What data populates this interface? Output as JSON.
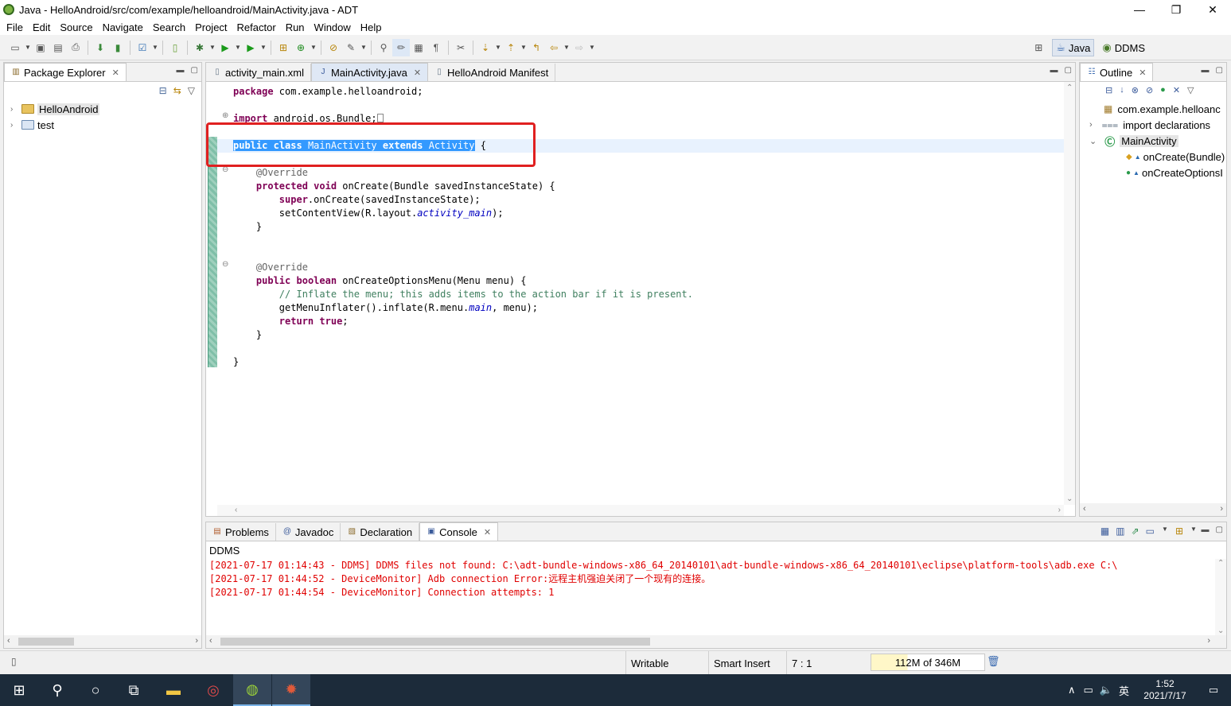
{
  "window": {
    "title": "Java - HelloAndroid/src/com/example/helloandroid/MainActivity.java - ADT",
    "minimize": "—",
    "restore": "❐",
    "close": "✕"
  },
  "menu": [
    "File",
    "Edit",
    "Source",
    "Navigate",
    "Search",
    "Project",
    "Refactor",
    "Run",
    "Window",
    "Help"
  ],
  "perspectives": {
    "java": "Java",
    "ddms": "DDMS"
  },
  "package_explorer": {
    "tab": "Package Explorer",
    "items": [
      {
        "label": "HelloAndroid"
      },
      {
        "label": "test"
      }
    ]
  },
  "editor": {
    "tabs": [
      "activity_main.xml",
      "MainActivity.java",
      "HelloAndroid Manifest"
    ],
    "active_tab": "MainActivity.java",
    "code": {
      "l1_kw": "package",
      "l1_rest": " com.example.helloandroid;",
      "l3_kw": "import",
      "l3_rest": " android.os.Bundle;",
      "l5_kw1": "public",
      "l5_kw2": "class",
      "l5_name": "MainActivity",
      "l5_kw3": "extends",
      "l5_super": "Activity",
      "l5_brace": " {",
      "l7": "@Override",
      "l8_kw1": "protected",
      "l8_kw2": "void",
      "l8_rest": " onCreate(Bundle savedInstanceState) {",
      "l9_kw": "super",
      "l9_rest": ".onCreate(savedInstanceState);",
      "l10_a": "setContentView(R.layout.",
      "l10_field": "activity_main",
      "l10_b": ");",
      "l11": "}",
      "l14": "@Override",
      "l15_kw1": "public",
      "l15_kw2": "boolean",
      "l15_rest": " onCreateOptionsMenu(Menu menu) {",
      "l16": "// Inflate the menu; this adds items to the action bar if it is present.",
      "l17_a": "getMenuInflater().inflate(R.menu.",
      "l17_field": "main",
      "l17_b": ", menu);",
      "l18_kw1": "return",
      "l18_kw2": "true",
      "l18_end": ";",
      "l19": "}",
      "l21": "}"
    }
  },
  "outline": {
    "tab": "Outline",
    "items": [
      {
        "label": "com.example.helloanc"
      },
      {
        "label": "import declarations"
      },
      {
        "label": "MainActivity"
      },
      {
        "label": "onCreate(Bundle)"
      },
      {
        "label": "onCreateOptionsI"
      }
    ]
  },
  "bottom": {
    "tabs": [
      "Problems",
      "Javadoc",
      "Declaration",
      "Console"
    ],
    "active_tab": "Console",
    "console_name": "DDMS",
    "lines": [
      "[2021-07-17 01:14:43 - DDMS] DDMS files not found: C:\\adt-bundle-windows-x86_64_20140101\\adt-bundle-windows-x86_64_20140101\\eclipse\\platform-tools\\adb.exe C:\\",
      "[2021-07-17 01:44:52 - DeviceMonitor] Adb connection Error:远程主机强迫关闭了一个现有的连接。",
      "[2021-07-17 01:44:54 - DeviceMonitor] Connection attempts: 1"
    ]
  },
  "status": {
    "writable": "Writable",
    "insert_mode": "Smart Insert",
    "position": "7 : 1",
    "heap": "112M of 346M",
    "heap_used_fraction": 0.32
  },
  "taskbar": {
    "tray_lang": "英",
    "time": "1:52",
    "date": "2021/7/17"
  },
  "colors": {
    "selection": "#3399ff",
    "highlight_box": "#e02020",
    "console_error": "#e00000",
    "keyword": "#7f0055"
  }
}
